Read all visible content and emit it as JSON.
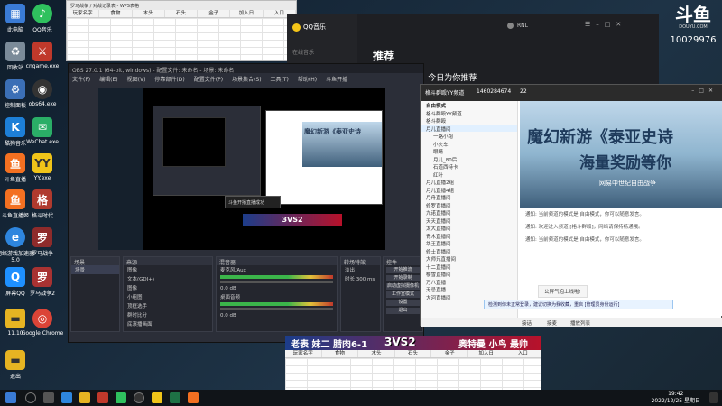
{
  "desktop": {
    "icons": [
      {
        "label": "此电脑",
        "icon": "computer-icon",
        "color": "#3a7bd5"
      },
      {
        "label": "QQ音乐",
        "icon": "qqmusic-icon",
        "color": "#2fc15e"
      },
      {
        "label": "回收站",
        "icon": "recycle-bin-icon",
        "color": "#7b8b99"
      },
      {
        "label": "cngame.exe",
        "icon": "game-icon",
        "color": "#c0392b"
      },
      {
        "label": "控制面板",
        "icon": "control-panel-icon",
        "color": "#3b6fb6"
      },
      {
        "label": "obs64.exe",
        "icon": "obs-icon",
        "color": "#333333"
      },
      {
        "label": "酷狗音乐",
        "icon": "kugou-icon",
        "color": "#1d7fd7"
      },
      {
        "label": "WeChat.exe",
        "icon": "wechat-icon",
        "color": "#2aae67"
      },
      {
        "label": "斗鱼直播",
        "icon": "douyu-icon",
        "color": "#f37021"
      },
      {
        "label": "YY.exe",
        "icon": "yy-icon",
        "color": "#f0c419"
      },
      {
        "label": "斗鱼直播姬",
        "icon": "douyu-ji-icon",
        "color": "#f37021"
      },
      {
        "label": "格斗时代",
        "icon": "fight-icon",
        "color": "#b03a2e"
      },
      {
        "label": "网络游戏加速器5.0",
        "icon": "accelerator-icon",
        "color": "#2e86de"
      },
      {
        "label": "罗马战争",
        "icon": "rome-icon",
        "color": "#8e2b2b"
      },
      {
        "label": "屏幕QQ",
        "icon": "qq-icon",
        "color": "#1e90ff"
      },
      {
        "label": "罗马战争2",
        "icon": "rome2-icon",
        "color": "#a83232"
      },
      {
        "label": "11.10",
        "icon": "folder-icon",
        "color": "#e6b422"
      },
      {
        "label": "Google Chrome",
        "icon": "chrome-icon",
        "color": "#db4437"
      },
      {
        "label": "退出",
        "icon": "exit-folder-icon",
        "color": "#e6b422"
      }
    ]
  },
  "sheet_top": {
    "title": "罗马战争 / 对战记录表 - WPS表格",
    "columns": [
      "玩家名字",
      "食物",
      "木头",
      "石头",
      "金子",
      "加入日",
      "入口"
    ]
  },
  "qqmusic": {
    "app_name": "QQ音乐",
    "nav": "在线音乐",
    "page_title": "推荐",
    "subtitle": "Hi，今日为你推荐",
    "user": "RNL"
  },
  "douyu": {
    "logo": "斗鱼",
    "domain": "DOUYU.COM",
    "room": "10029976"
  },
  "obs": {
    "title": "OBS 27.0.1 (64-bit, windows) - 配置文件: 未命名 - 场景: 未命名",
    "menu": [
      "文件(F)",
      "编辑(E)",
      "视图(V)",
      "停靠部件(D)",
      "配置文件(P)",
      "场景集合(S)",
      "工具(T)",
      "帮助(H)",
      "斗鱼开播"
    ],
    "docks": {
      "scenes": {
        "title": "场景",
        "items": [
          "场景"
        ]
      },
      "sources": {
        "title": "来源",
        "items": [
          "图像",
          "文本(GDI+)",
          "图像",
          "小组图",
          "顶框选手",
          "群时比分",
          "底滚播画面"
        ]
      },
      "mixer": {
        "title": "混音器",
        "items": [
          "麦克风/Aux",
          "桌面音频",
          "0.0 dB",
          "0.0 dB"
        ]
      },
      "transitions": {
        "title": "转场特效",
        "items": [
          "淡出",
          "时长 300 ms"
        ]
      },
      "controls": {
        "title": "控件",
        "buttons": [
          "开始推流",
          "开始录制",
          "启动虚拟摄像机",
          "工作室模式",
          "设置",
          "退出"
        ]
      }
    },
    "overlay_note": "斗鱼开播直播成功"
  },
  "yy": {
    "channel_name": "格斗群殴YY频道",
    "channel_id": "1460284674",
    "online": "22",
    "mode": "自由模式",
    "channel_list": [
      "格斗群殴YY频道",
      "格斗群殴",
      "月儿直播间",
      "一路小跑",
      "小火车",
      "眼睛",
      "月儿_80后",
      "石道西特卡",
      "红叶",
      "月儿直播2组",
      "月儿直播4组",
      "月舟直播间",
      "修罗直播间",
      "九诺直播间",
      "天天直播间",
      "太大直播间",
      "青木直播间",
      "华王直播间",
      "修士直播间",
      "大师兄直播间",
      "十二直播间",
      "樱雪直播间",
      "万八直播",
      "无忌直播",
      "大河直播间"
    ],
    "video_title": "魔幻新游《泰亚史诗",
    "video_sub": "海量奖励等你",
    "video_tagline": "网易中世纪自由战争",
    "chat": [
      "通知: 当前频道的模式是 自由模式，你可以随意发言。",
      "通知: 欢迎进入频道 [格斗群殴]，网络请保持畅通哦。",
      "通知: 当前频道的模式是 自由模式，你可以随意发言。"
    ],
    "banner_tip": "公屏气泡上线啦!",
    "warn_tip": "检测到你未正常登录，建议切换为我收藏，重启 [管理员身份运行]",
    "bottom_items": [
      "接话",
      "接麦",
      "播放列表"
    ]
  },
  "scoreboard": {
    "left_team": "老表 妹二 腊肉6-1",
    "score": "3VS2",
    "right_team": "奥特曼 小鸟 最帅"
  },
  "sheet_bottom": {
    "columns": [
      "玩家名字",
      "食物",
      "木头",
      "石头",
      "金子",
      "加入日",
      "入口"
    ]
  },
  "taskbar": {
    "time": "19:42",
    "date": "2022/12/25 星期日"
  }
}
